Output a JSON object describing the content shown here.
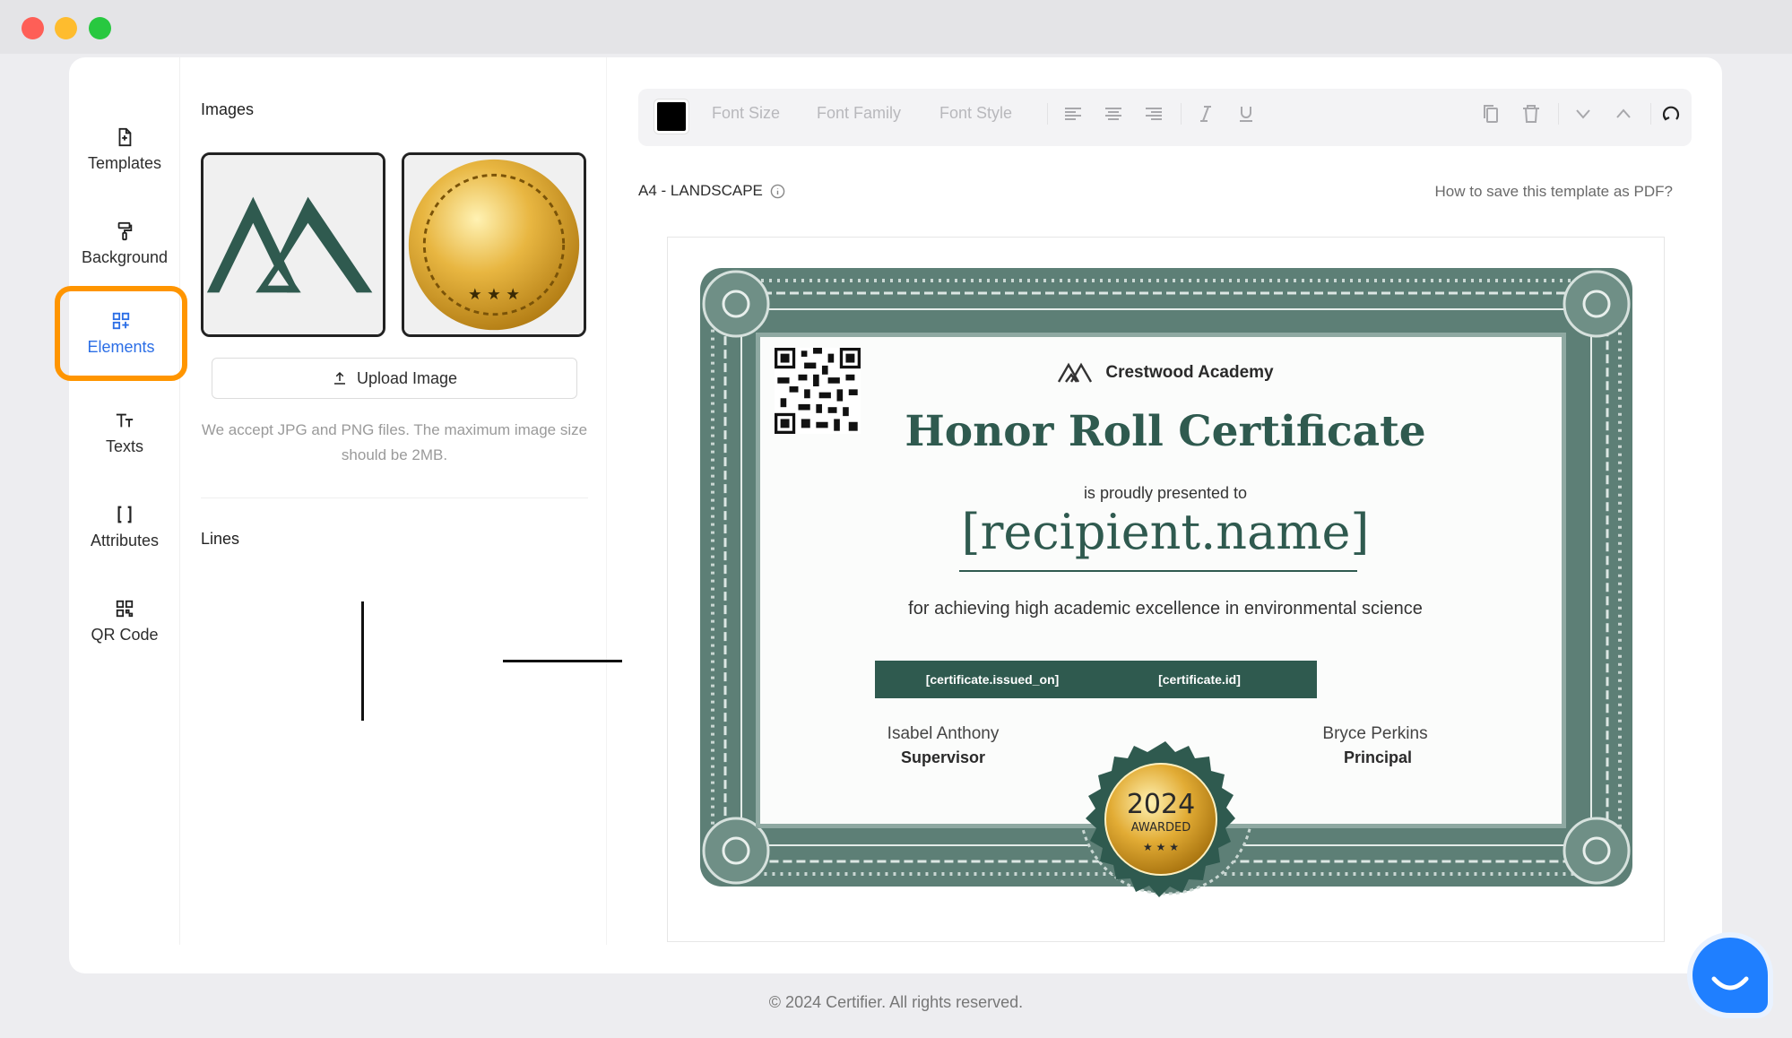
{
  "nav": {
    "items": [
      {
        "label": "Templates",
        "icon": "file-icon"
      },
      {
        "label": "Background",
        "icon": "paint-roller-icon"
      },
      {
        "label": "Elements",
        "icon": "elements-icon",
        "active": true
      },
      {
        "label": "Texts",
        "icon": "text-icon"
      },
      {
        "label": "Attributes",
        "icon": "brackets-icon"
      },
      {
        "label": "QR Code",
        "icon": "qr-code-icon"
      }
    ],
    "active_color": "#2b6ee6",
    "highlight_color": "#ff9500"
  },
  "panel": {
    "images_title": "Images",
    "upload_label": "Upload Image",
    "upload_note": "We accept JPG and PNG files. The maximum image size should be 2MB.",
    "lines_title": "Lines"
  },
  "toolbar": {
    "font_size": "Font Size",
    "font_family": "Font Family",
    "font_style": "Font Style",
    "current_color": "#000000"
  },
  "canvas": {
    "page_size": "A4 - LANDSCAPE",
    "help_link": "How to save this template as PDF?"
  },
  "certificate": {
    "academy": "Crestwood Academy",
    "title": "Honor Roll Certificate",
    "presented": "is proudly presented to",
    "recipient": "[recipient.name]",
    "reason": "for achieving high academic excellence in environmental science",
    "issued_on": "[certificate.issued_on]",
    "cert_id": "[certificate.id]",
    "signer1_name": "Isabel Anthony",
    "signer1_role": "Supervisor",
    "signer2_name": "Bryce Perkins",
    "signer2_role": "Principal",
    "seal_year": "2024",
    "seal_text": "AWARDED",
    "primary_color": "#2f5a4f",
    "border_color": "#5d7f76"
  },
  "footer": {
    "copyright": "© 2024 Certifier. All rights reserved."
  }
}
